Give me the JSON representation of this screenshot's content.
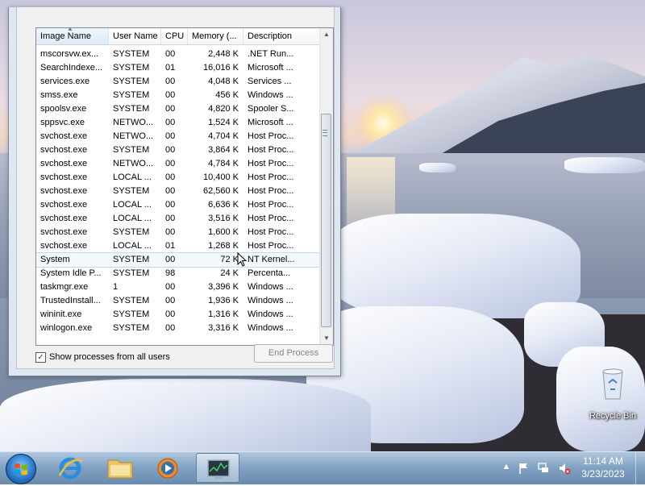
{
  "task_manager": {
    "columns": [
      "Image Name",
      "User Name",
      "CPU",
      "Memory (...",
      "Description"
    ],
    "rows": [
      {
        "image": "mscorsvw.ex...",
        "user": "SYSTEM",
        "cpu": "00",
        "memory": "2,448 K",
        "desc": ".NET Run..."
      },
      {
        "image": "SearchIndexe...",
        "user": "SYSTEM",
        "cpu": "01",
        "memory": "16,016 K",
        "desc": "Microsoft ..."
      },
      {
        "image": "services.exe",
        "user": "SYSTEM",
        "cpu": "00",
        "memory": "4,048 K",
        "desc": "Services ..."
      },
      {
        "image": "smss.exe",
        "user": "SYSTEM",
        "cpu": "00",
        "memory": "456 K",
        "desc": "Windows ..."
      },
      {
        "image": "spoolsv.exe",
        "user": "SYSTEM",
        "cpu": "00",
        "memory": "4,820 K",
        "desc": "Spooler S..."
      },
      {
        "image": "sppsvc.exe",
        "user": "NETWO...",
        "cpu": "00",
        "memory": "1,524 K",
        "desc": "Microsoft ..."
      },
      {
        "image": "svchost.exe",
        "user": "NETWO...",
        "cpu": "00",
        "memory": "4,704 K",
        "desc": "Host Proc..."
      },
      {
        "image": "svchost.exe",
        "user": "SYSTEM",
        "cpu": "00",
        "memory": "3,864 K",
        "desc": "Host Proc..."
      },
      {
        "image": "svchost.exe",
        "user": "NETWO...",
        "cpu": "00",
        "memory": "4,784 K",
        "desc": "Host Proc..."
      },
      {
        "image": "svchost.exe",
        "user": "LOCAL ...",
        "cpu": "00",
        "memory": "10,400 K",
        "desc": "Host Proc..."
      },
      {
        "image": "svchost.exe",
        "user": "SYSTEM",
        "cpu": "00",
        "memory": "62,560 K",
        "desc": "Host Proc..."
      },
      {
        "image": "svchost.exe",
        "user": "LOCAL ...",
        "cpu": "00",
        "memory": "6,636 K",
        "desc": "Host Proc..."
      },
      {
        "image": "svchost.exe",
        "user": "LOCAL ...",
        "cpu": "00",
        "memory": "3,516 K",
        "desc": "Host Proc..."
      },
      {
        "image": "svchost.exe",
        "user": "SYSTEM",
        "cpu": "00",
        "memory": "1,600 K",
        "desc": "Host Proc..."
      },
      {
        "image": "svchost.exe",
        "user": "LOCAL ...",
        "cpu": "01",
        "memory": "1,268 K",
        "desc": "Host Proc..."
      },
      {
        "image": "System",
        "user": "SYSTEM",
        "cpu": "00",
        "memory": "72 K",
        "desc": "NT Kernel..."
      },
      {
        "image": "System Idle P...",
        "user": "SYSTEM",
        "cpu": "98",
        "memory": "24 K",
        "desc": "Percenta..."
      },
      {
        "image": "taskmgr.exe",
        "user": "1",
        "cpu": "00",
        "memory": "3,396 K",
        "desc": "Windows ..."
      },
      {
        "image": "TrustedInstall...",
        "user": "SYSTEM",
        "cpu": "00",
        "memory": "1,936 K",
        "desc": "Windows ..."
      },
      {
        "image": "wininit.exe",
        "user": "SYSTEM",
        "cpu": "00",
        "memory": "1,316 K",
        "desc": "Windows ..."
      },
      {
        "image": "winlogon.exe",
        "user": "SYSTEM",
        "cpu": "00",
        "memory": "3,316 K",
        "desc": "Windows ..."
      }
    ],
    "hovered_row_index": 15,
    "show_all_users_label": "Show processes from all users",
    "show_all_users_checked": true,
    "check_mark": "✓",
    "end_process_label": "End Process"
  },
  "desktop": {
    "recycle_bin_label": "Recycle Bin"
  },
  "taskbar": {
    "buttons": [
      "start-button",
      "internet-explorer",
      "windows-explorer",
      "windows-media-player",
      "task-manager"
    ],
    "active_button": "task-manager",
    "clock_time": "11:14 AM",
    "clock_date": "3/23/2023",
    "tray_icons": [
      "show-hidden-icons",
      "action-center-flag-icon",
      "network-icon",
      "volume-muted-icon"
    ]
  },
  "colors": {
    "taskbar": "#7a9bc0",
    "selection_hover": "#f3f8fd",
    "window_frame": "#dfe7f0"
  }
}
